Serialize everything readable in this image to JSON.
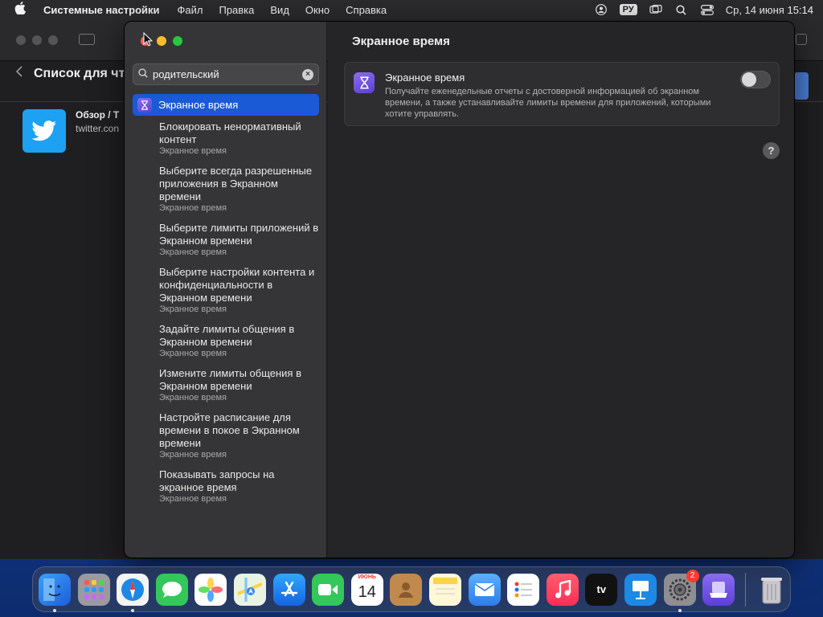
{
  "menubar": {
    "app_name": "Системные настройки",
    "items": [
      "Файл",
      "Правка",
      "Вид",
      "Окно",
      "Справка"
    ],
    "input_lang": "РУ",
    "datetime": "Ср, 14 июня  15:14"
  },
  "background_window": {
    "list_title": "Список для чт",
    "item_title": "Обзор / Т",
    "item_url": "twitter.con"
  },
  "sidebar": {
    "search": {
      "value": "родительский"
    },
    "top_result": {
      "label": "Экранное время"
    },
    "results": [
      {
        "title": "Блокировать ненормативный контент",
        "sub": "Экранное время"
      },
      {
        "title": "Выберите всегда разрешенные приложения в Экранном времени",
        "sub": "Экранное время"
      },
      {
        "title": "Выберите лимиты приложений в Экранном времени",
        "sub": "Экранное время"
      },
      {
        "title": "Выберите настройки контента и конфиденциальности в Экранном времени",
        "sub": "Экранное время"
      },
      {
        "title": "Задайте лимиты общения в Экранном времени",
        "sub": "Экранное время"
      },
      {
        "title": "Измените лимиты общения в Экранном времени",
        "sub": "Экранное время"
      },
      {
        "title": "Настройте расписание для времени в покое в Экранном времени",
        "sub": "Экранное время"
      },
      {
        "title": "Показывать запросы на экранное время",
        "sub": "Экранное время"
      }
    ]
  },
  "content": {
    "title": "Экранное время",
    "card": {
      "title": "Экранное время",
      "description": "Получайте еженедельные отчеты с достоверной информацией об экранном времени, а также устанавливайте лимиты времени для приложений, которыми хотите управлять.",
      "enabled": false
    },
    "help_label": "?"
  },
  "dock": {
    "calendar_month": "ИЮНЬ",
    "calendar_day": "14",
    "settings_badge": "2",
    "appletv_label": "tv"
  },
  "colors": {
    "accent": "#1a5ad6",
    "screen_time_icon": "#6b4fe0"
  }
}
